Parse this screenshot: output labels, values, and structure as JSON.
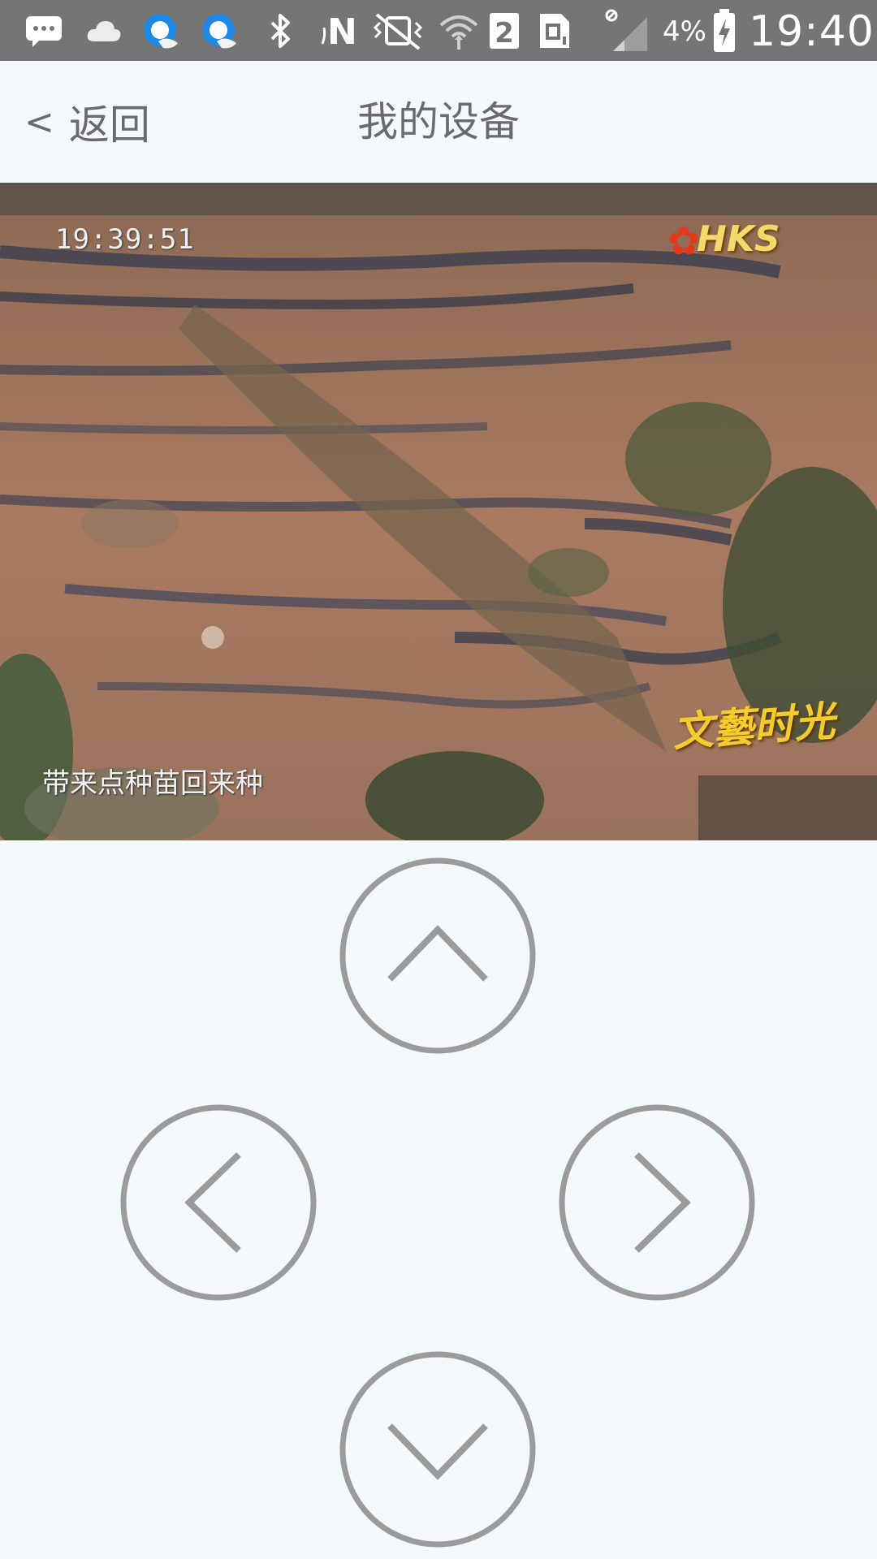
{
  "status_bar": {
    "icons": [
      "message-icon",
      "cloud-icon",
      "qq-browser-icon",
      "qq-browser-icon",
      "bluetooth-icon",
      "nfc-icon",
      "vibrate-icon",
      "wifi-icon",
      "sim-2-icon",
      "sim-card-icon",
      "signal-icon",
      "battery-charging-icon"
    ],
    "battery_percent": "4%",
    "time": "19:40"
  },
  "header": {
    "back_label": "< 返回",
    "back_chevron": "<",
    "back_text": "返回",
    "title": "我的设备"
  },
  "video": {
    "timestamp": "19:39:51",
    "channel_logo": "HKS",
    "caption": "带来点种苗回来种",
    "program_logo": "文藝时光"
  },
  "controls": {
    "up": "chevron-up-icon",
    "left": "chevron-left-icon",
    "right": "chevron-right-icon",
    "down": "chevron-down-icon"
  },
  "colors": {
    "status_bar": "#757575",
    "background": "#f3f9fd",
    "control_stroke": "#9b9b9b",
    "header_text": "#6b6b6b"
  }
}
